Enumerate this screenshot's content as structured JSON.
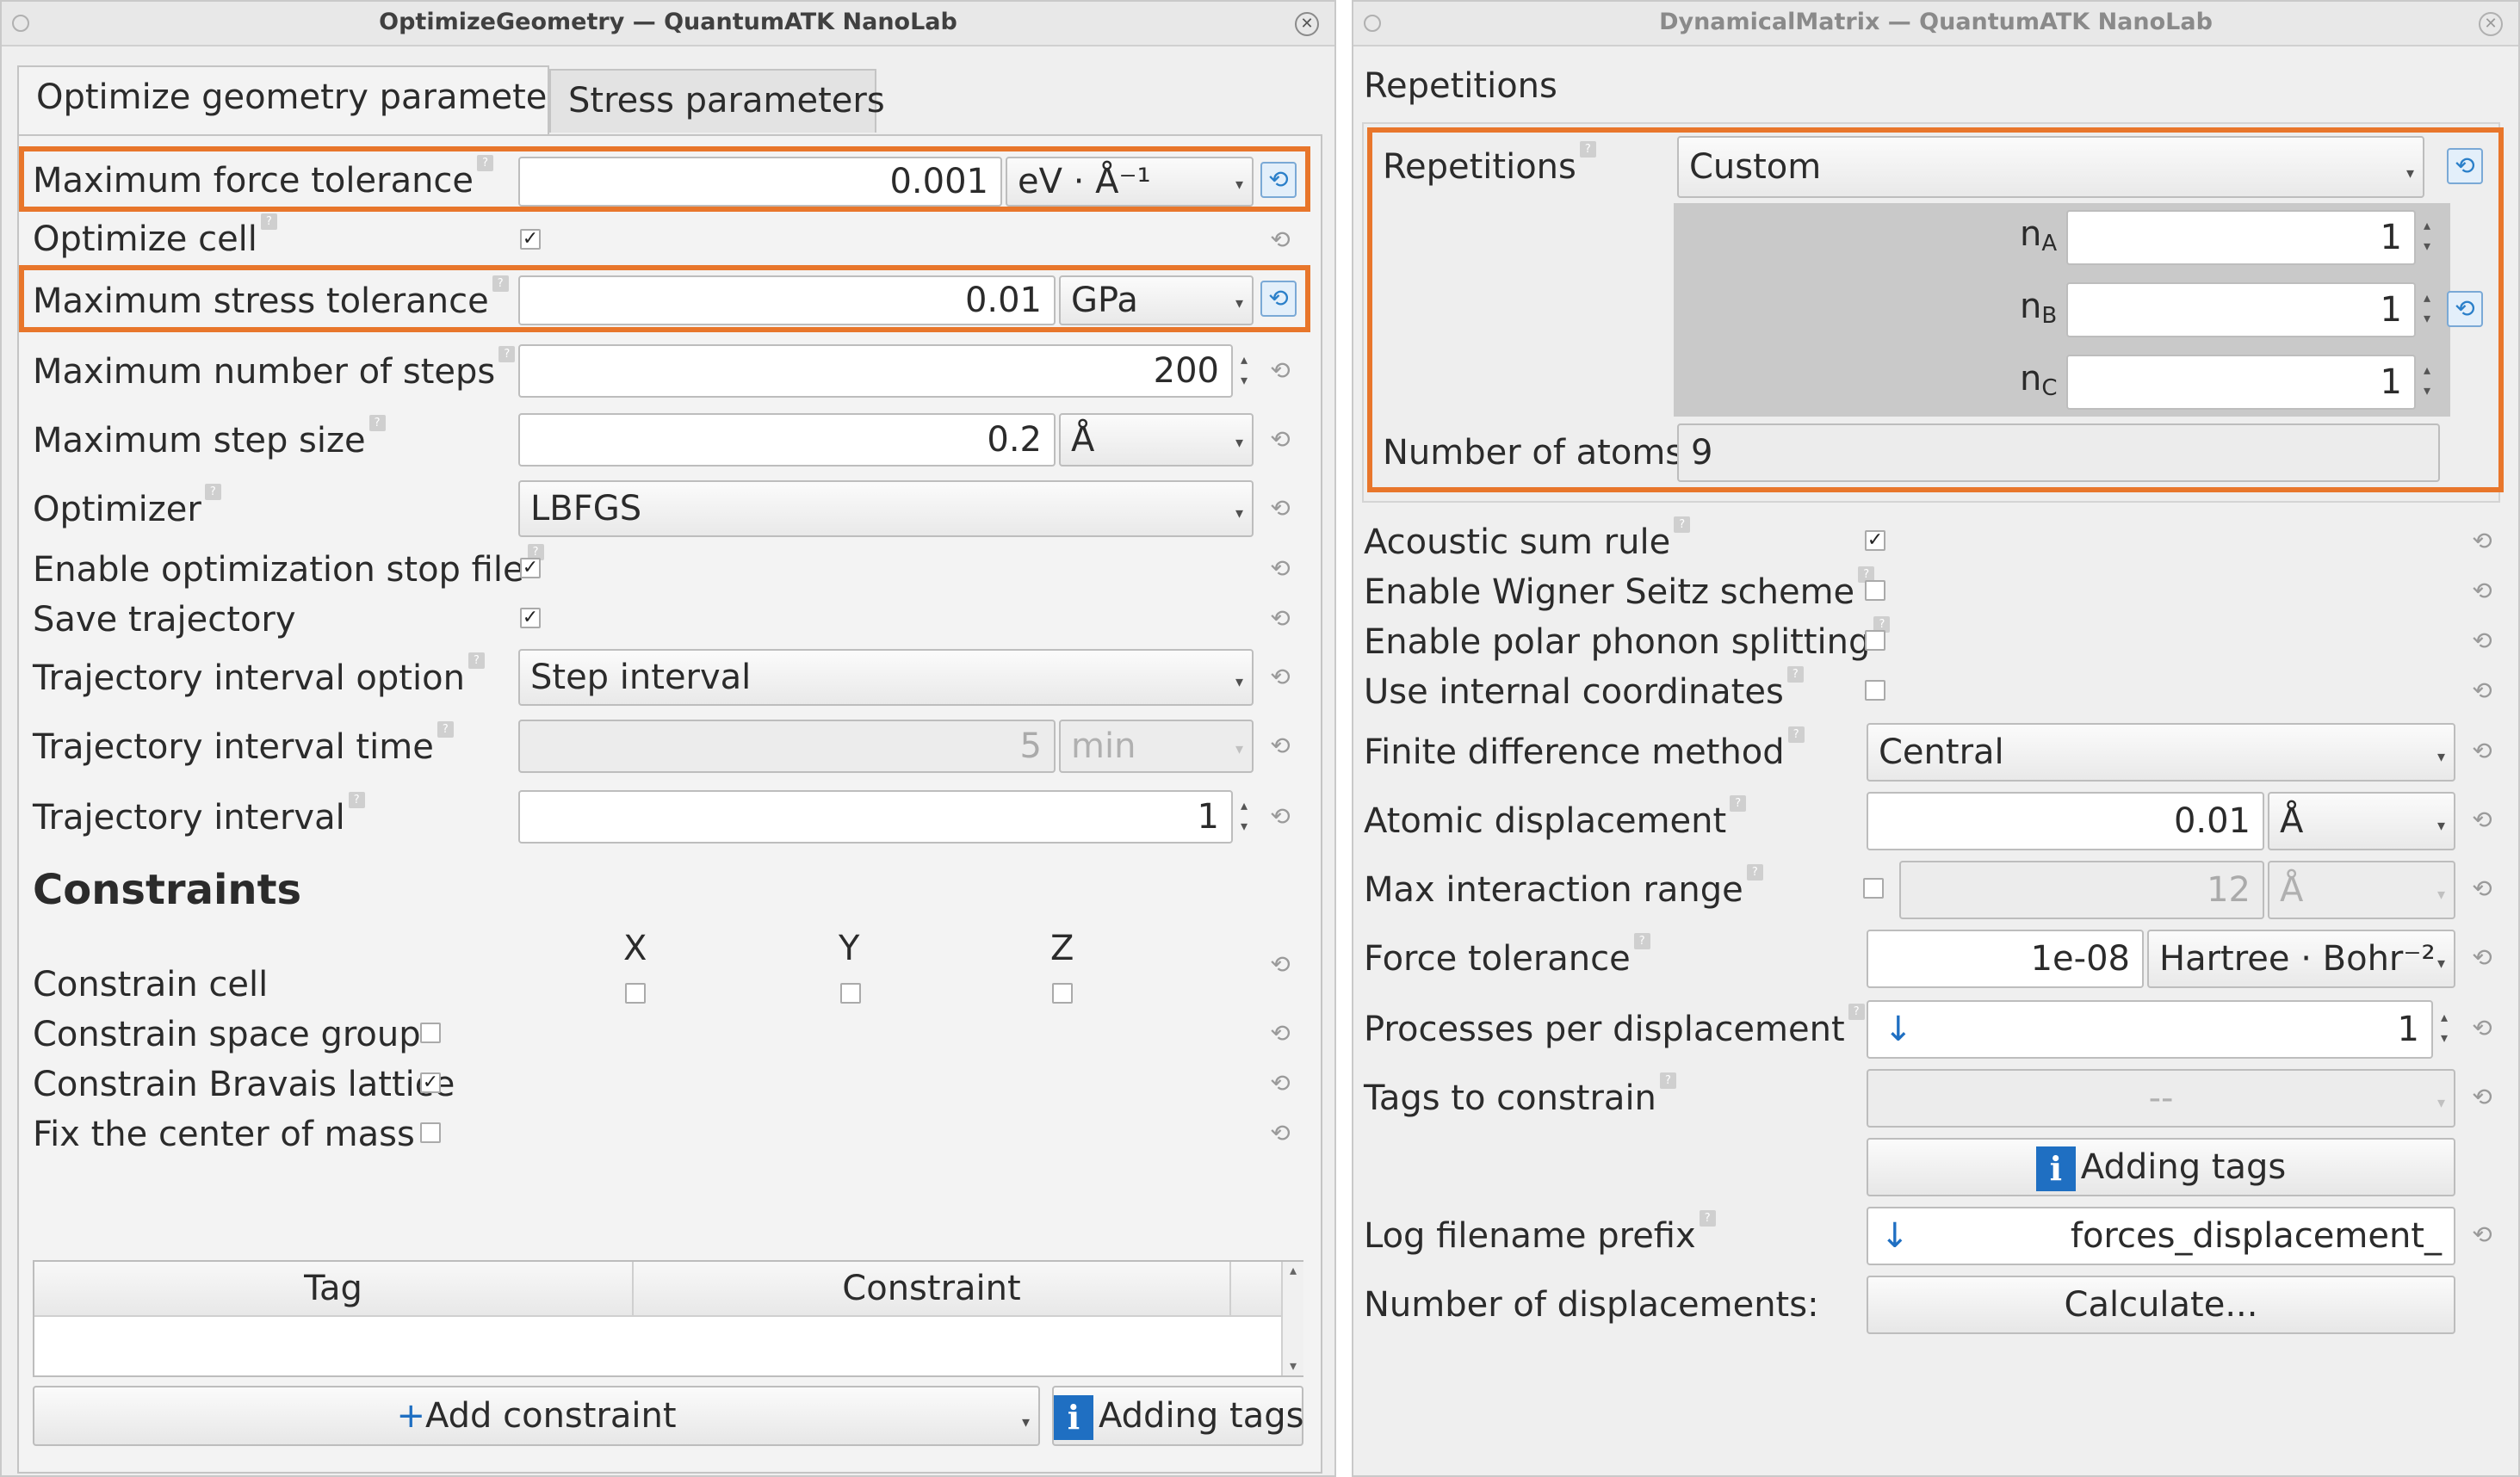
{
  "left": {
    "title": "OptimizeGeometry — QuantumATK NanoLab",
    "tabs": [
      "Optimize geometry parameters",
      "Stress parameters"
    ],
    "max_force": {
      "label": "Maximum force tolerance",
      "value": "0.001",
      "unit": "eV · Å⁻¹"
    },
    "optimize_cell": {
      "label": "Optimize cell",
      "checked": true
    },
    "max_stress": {
      "label": "Maximum stress tolerance",
      "value": "0.01",
      "unit": "GPa"
    },
    "max_steps": {
      "label": "Maximum number of steps",
      "value": "200"
    },
    "max_step_size": {
      "label": "Maximum step size",
      "value": "0.2",
      "unit": "Å"
    },
    "optimizer": {
      "label": "Optimizer",
      "value": "LBFGS"
    },
    "stop_file": {
      "label": "Enable optimization stop file",
      "checked": true
    },
    "save_traj": {
      "label": "Save trajectory",
      "checked": true
    },
    "traj_option": {
      "label": "Trajectory interval option",
      "value": "Step interval"
    },
    "traj_time": {
      "label": "Trajectory interval time",
      "value": "5",
      "unit": "min"
    },
    "traj_interval": {
      "label": "Trajectory interval",
      "value": "1"
    },
    "constraints": {
      "heading": "Constraints",
      "axes": [
        "X",
        "Y",
        "Z"
      ],
      "cell_label": "Constrain cell",
      "space_group_label": "Constrain space group",
      "bravais_label": "Constrain Bravais lattice",
      "com_label": "Fix the center of mass"
    },
    "table": {
      "col_tag": "Tag",
      "col_constraint": "Constraint"
    },
    "add_constraint": "Add constraint",
    "adding_tags": "Adding tags"
  },
  "right": {
    "title": "DynamicalMatrix — QuantumATK NanoLab",
    "section_title": "Repetitions",
    "repetitions": {
      "label": "Repetitions",
      "value": "Custom"
    },
    "na": {
      "label": "n",
      "sub": "A",
      "value": "1"
    },
    "nb": {
      "label": "n",
      "sub": "B",
      "value": "1"
    },
    "nc": {
      "label": "n",
      "sub": "C",
      "value": "1"
    },
    "atoms": {
      "label": "Number of atoms:",
      "value": "9"
    },
    "acoustic": {
      "label": "Acoustic sum rule",
      "checked": true
    },
    "wigner": {
      "label": "Enable Wigner Seitz scheme",
      "checked": false
    },
    "polar": {
      "label": "Enable polar phonon splitting",
      "checked": false
    },
    "internal": {
      "label": "Use internal coordinates",
      "checked": false
    },
    "finite_diff": {
      "label": "Finite difference method",
      "value": "Central"
    },
    "atomic_disp": {
      "label": "Atomic displacement",
      "value": "0.01",
      "unit": "Å"
    },
    "max_range": {
      "label": "Max interaction range",
      "value": "12",
      "unit": "Å"
    },
    "force_tol": {
      "label": "Force tolerance",
      "value": "1e-08",
      "unit": "Hartree · Bohr⁻²"
    },
    "processes": {
      "label": "Processes per displacement",
      "value": "1"
    },
    "tags": {
      "label": "Tags to constrain",
      "value": "--"
    },
    "adding_tags": "Adding tags",
    "log_prefix": {
      "label": "Log filename prefix",
      "value": "forces_displacement_"
    },
    "num_disp": {
      "label": "Number of displacements:",
      "button": "Calculate..."
    }
  },
  "colors": {
    "highlight": "#e8762b",
    "accent": "#1f6fc2"
  },
  "icons": [
    "close-icon",
    "help-icon",
    "reset-icon",
    "dropdown-arrow-icon",
    "spin-arrows-icon",
    "checkbox-icon",
    "info-icon",
    "down-arrow-icon",
    "plus-icon"
  ]
}
